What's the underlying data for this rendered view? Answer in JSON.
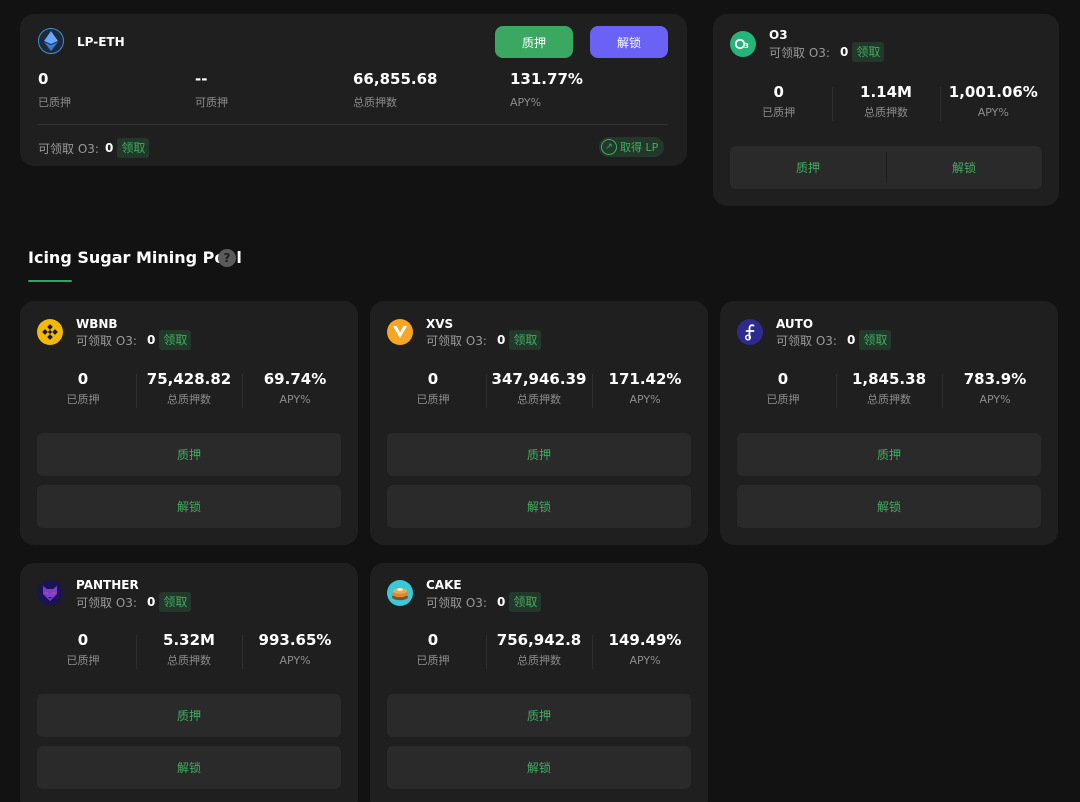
{
  "lp_card": {
    "token_name": "LP-ETH",
    "stake_label": "质押",
    "unstake_label": "解锁",
    "stats": [
      {
        "value": "0",
        "label": "已质押"
      },
      {
        "value": "--",
        "label": "可质押"
      },
      {
        "value": "66,855.68",
        "label": "总质押数"
      },
      {
        "value": "131.77%",
        "label": "APY%"
      }
    ],
    "claimable_label": "可领取 O3:",
    "claimable_amount": "0",
    "claim_label": "领取",
    "get_lp_label": "取得 LP"
  },
  "o3_card": {
    "token_name": "O3",
    "claimable_label": "可领取 O3:",
    "claimable_amount": "0",
    "claim_label": "领取",
    "stats": [
      {
        "value": "0",
        "label": "已质押"
      },
      {
        "value": "1.14M",
        "label": "总质押数"
      },
      {
        "value": "1,001.06%",
        "label": "APY%"
      }
    ],
    "stake_label": "质押",
    "unstake_label": "解锁"
  },
  "section": {
    "title": "Icing Sugar Mining Pool",
    "help_glyph": "?"
  },
  "pools": [
    {
      "token_name": "WBNB",
      "claimable_label": "可领取 O3:",
      "claimable_amount": "0",
      "claim_label": "领取",
      "stats": [
        {
          "value": "0",
          "label": "已质押"
        },
        {
          "value": "75,428.82",
          "label": "总质押数"
        },
        {
          "value": "69.74%",
          "label": "APY%"
        }
      ],
      "stake_label": "质押",
      "unstake_label": "解锁"
    },
    {
      "token_name": "XVS",
      "claimable_label": "可领取 O3:",
      "claimable_amount": "0",
      "claim_label": "领取",
      "stats": [
        {
          "value": "0",
          "label": "已质押"
        },
        {
          "value": "347,946.39",
          "label": "总质押数"
        },
        {
          "value": "171.42%",
          "label": "APY%"
        }
      ],
      "stake_label": "质押",
      "unstake_label": "解锁"
    },
    {
      "token_name": "AUTO",
      "claimable_label": "可领取 O3:",
      "claimable_amount": "0",
      "claim_label": "领取",
      "stats": [
        {
          "value": "0",
          "label": "已质押"
        },
        {
          "value": "1,845.38",
          "label": "总质押数"
        },
        {
          "value": "783.9%",
          "label": "APY%"
        }
      ],
      "stake_label": "质押",
      "unstake_label": "解锁"
    },
    {
      "token_name": "PANTHER",
      "claimable_label": "可领取 O3:",
      "claimable_amount": "0",
      "claim_label": "领取",
      "stats": [
        {
          "value": "0",
          "label": "已质押"
        },
        {
          "value": "5.32M",
          "label": "总质押数"
        },
        {
          "value": "993.65%",
          "label": "APY%"
        }
      ],
      "stake_label": "质押",
      "unstake_label": "解锁"
    },
    {
      "token_name": "CAKE",
      "claimable_label": "可领取 O3:",
      "claimable_amount": "0",
      "claim_label": "领取",
      "stats": [
        {
          "value": "0",
          "label": "已质押"
        },
        {
          "value": "756,942.8",
          "label": "总质押数"
        },
        {
          "value": "149.49%",
          "label": "APY%"
        }
      ],
      "stake_label": "质押",
      "unstake_label": "解锁"
    }
  ],
  "colors": {
    "background": "#121212",
    "card": "#1f1f1f",
    "button": "#2a2a2a",
    "accent_green": "#3fae5f",
    "stake_button": "#3aa861",
    "unstake_button": "#6a61f5"
  },
  "icons": {
    "lp": "ethereum-icon",
    "o3": "o3-logo-icon",
    "wbnb": "bnb-icon",
    "xvs": "venus-icon",
    "auto": "auto-icon",
    "panther": "panther-icon",
    "cake": "pancake-icon"
  }
}
